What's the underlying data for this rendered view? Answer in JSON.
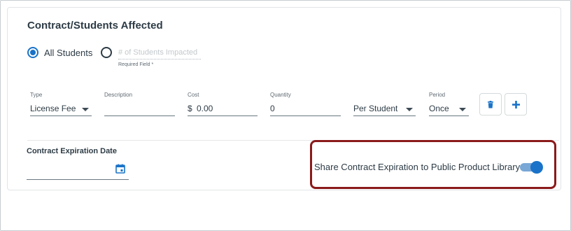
{
  "section": {
    "title": "Contract/Students Affected"
  },
  "students": {
    "all_label": "All Students",
    "count_placeholder": "# of Students Impacted",
    "count_value": "",
    "helper": "Required Field *",
    "selected": "all"
  },
  "fields": {
    "type": {
      "label": "Type",
      "value": "License Fee"
    },
    "description": {
      "label": "Description",
      "value": ""
    },
    "cost": {
      "label": "Cost",
      "prefix": "$",
      "value": "0.00"
    },
    "quantity": {
      "label": "Quantity",
      "value": "0"
    },
    "unit": {
      "label": "",
      "value": "Per Student"
    },
    "period": {
      "label": "Period",
      "value": "Once"
    }
  },
  "buttons": {
    "delete_icon": "trash-icon",
    "add_icon": "plus-icon"
  },
  "expiration": {
    "label": "Contract Expiration Date",
    "value": ""
  },
  "share": {
    "label": "Share Contract Expiration to Public Product Library",
    "enabled": true
  },
  "colors": {
    "accent": "#1a73c8",
    "highlight_border": "#8b1a1a",
    "toggle_track": "#79a7d6"
  }
}
